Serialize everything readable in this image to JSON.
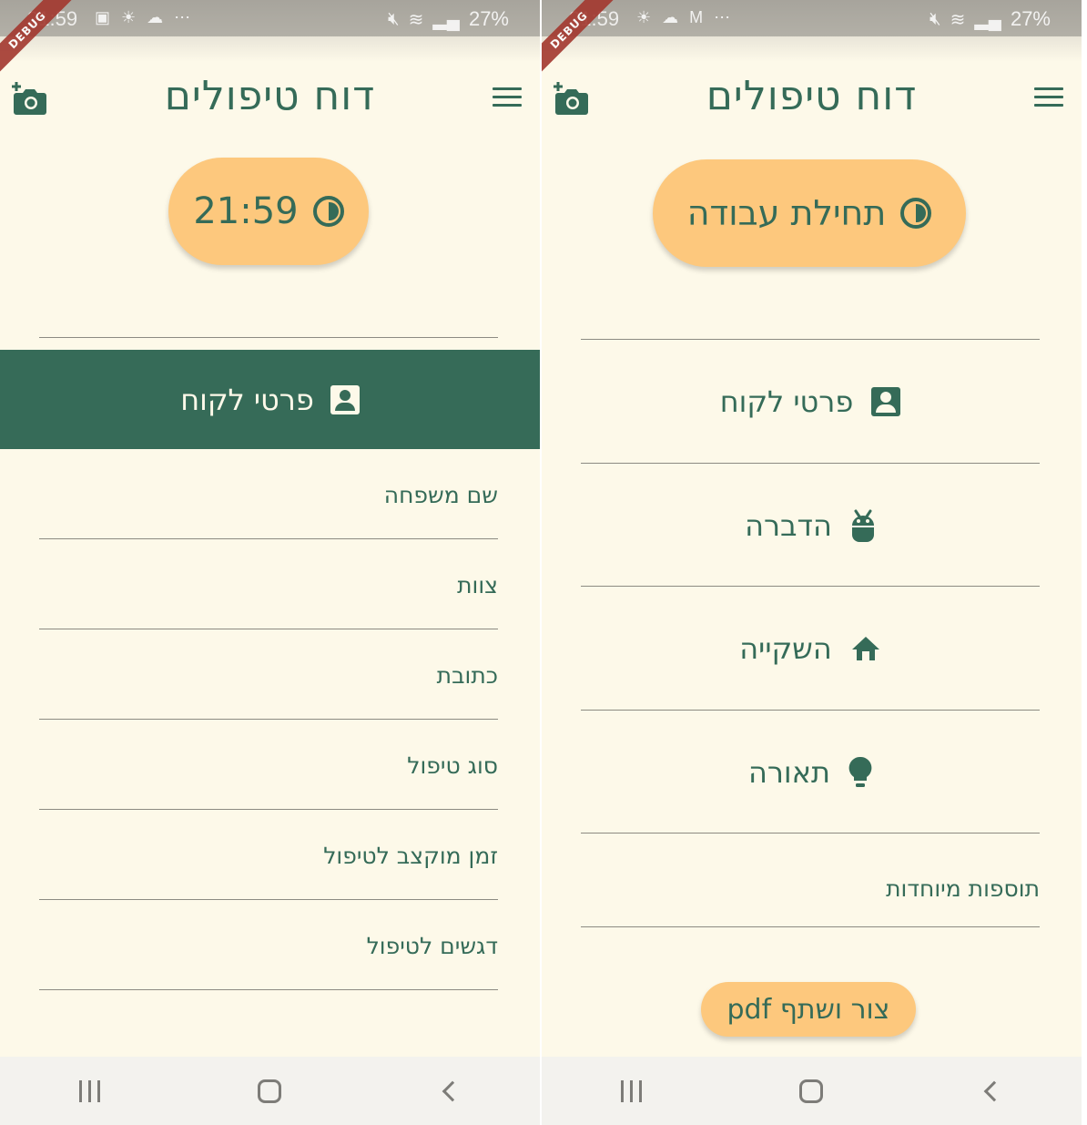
{
  "status_bar": {
    "time": "21:59",
    "battery": "27%"
  },
  "debug_banner": "DEBUG",
  "app": {
    "title": "דוח טיפולים"
  },
  "left_screen": {
    "timer_label": "21:59",
    "section_title": "פרטי לקוח",
    "fields": [
      {
        "label": "שם משפחה"
      },
      {
        "label": "צוות"
      },
      {
        "label": "כתובת"
      },
      {
        "label": "סוג טיפול"
      },
      {
        "label": "זמן מוקצב לטיפול"
      },
      {
        "label": "דגשים לטיפול"
      }
    ]
  },
  "right_screen": {
    "start_button_label": "תחילת עבודה",
    "menu_items": [
      {
        "label": "פרטי לקוח",
        "icon": "contact-card-icon"
      },
      {
        "label": "הדברה",
        "icon": "bug-icon"
      },
      {
        "label": "השקייה",
        "icon": "home-icon"
      },
      {
        "label": "תאורה",
        "icon": "lightbulb-icon"
      }
    ],
    "extras_label": "תוספות מיוחדות",
    "pdf_button_label": "צור ושתף pdf"
  },
  "colors": {
    "background": "#fdf9e9",
    "primary": "#356b58",
    "accent": "#fdc87d",
    "nav_bar": "#f3f2ee"
  }
}
